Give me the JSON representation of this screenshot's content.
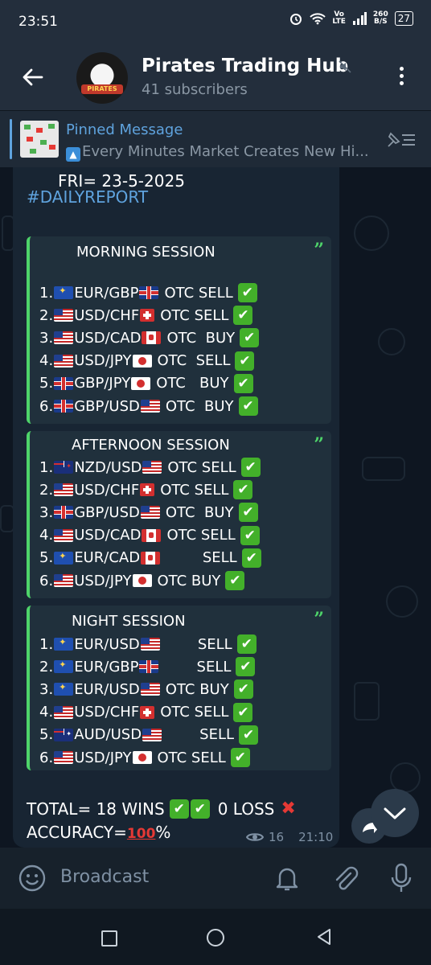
{
  "status": {
    "time": "23:51",
    "net_top": "Vo",
    "net_bottom": "LTE",
    "speed_top": "260",
    "speed_bottom": "B/S",
    "battery": "27"
  },
  "channel": {
    "title": "Pirates Trading Hub",
    "subtitle": "41 subscribers",
    "avatar_text": "PIRATES"
  },
  "pinned": {
    "label": "Pinned Message",
    "text": "Every Minutes Market Creates New Hi..."
  },
  "message": {
    "date_line": "FRI= 23-5-2025",
    "hashtag": "#DAILYREPORT",
    "sessions": [
      {
        "title": "MORNING SESSION",
        "rows": [
          {
            "num": "1.",
            "a": "EUR",
            "b": "GBP",
            "fa": "eu",
            "fb": "gb",
            "side": "OTC SELL"
          },
          {
            "num": "2.",
            "a": "USD",
            "b": "CHF",
            "fa": "us",
            "fb": "ch",
            "side": "OTC SELL"
          },
          {
            "num": "3.",
            "a": "USD",
            "b": "CAD",
            "fa": "us",
            "fb": "ca",
            "side": "OTC  BUY"
          },
          {
            "num": "4.",
            "a": "USD",
            "b": "JPY",
            "fa": "us",
            "fb": "jp",
            "side": "OTC  SELL"
          },
          {
            "num": "5.",
            "a": "GBP",
            "b": "JPY",
            "fa": "gb",
            "fb": "jp",
            "side": "OTC   BUY"
          },
          {
            "num": "6.",
            "a": "GBP",
            "b": "USD",
            "fa": "gb",
            "fb": "us",
            "side": "OTC  BUY"
          }
        ]
      },
      {
        "title": "AFTERNOON SESSION",
        "rows": [
          {
            "num": "1.",
            "a": "NZD",
            "b": "USD",
            "fa": "nz",
            "fb": "us",
            "side": "OTC SELL"
          },
          {
            "num": "2.",
            "a": "USD",
            "b": "CHF",
            "fa": "us",
            "fb": "ch",
            "side": "OTC SELL"
          },
          {
            "num": "3.",
            "a": "GBP",
            "b": "USD",
            "fa": "gb",
            "fb": "us",
            "side": "OTC  BUY"
          },
          {
            "num": "4.",
            "a": "USD",
            "b": "CAD",
            "fa": "us",
            "fb": "ca",
            "side": "OTC SELL"
          },
          {
            "num": "5.",
            "a": "EUR",
            "b": "CAD",
            "fa": "eu",
            "fb": "ca",
            "side": "        SELL"
          },
          {
            "num": "6.",
            "a": "USD",
            "b": "JPY",
            "fa": "us",
            "fb": "jp",
            "side": "OTC BUY"
          }
        ]
      },
      {
        "title": "NIGHT SESSION",
        "rows": [
          {
            "num": "1.",
            "a": "EUR",
            "b": "USD",
            "fa": "eu",
            "fb": "us",
            "side": "       SELL"
          },
          {
            "num": "2.",
            "a": "EUR",
            "b": "GBP",
            "fa": "eu",
            "fb": "gb",
            "side": "       SELL"
          },
          {
            "num": "3.",
            "a": "EUR",
            "b": "USD",
            "fa": "eu",
            "fb": "us",
            "side": "OTC BUY"
          },
          {
            "num": "4.",
            "a": "USD",
            "b": "CHF",
            "fa": "us",
            "fb": "ch",
            "side": "OTC SELL"
          },
          {
            "num": "5.",
            "a": "AUD",
            "b": "USD",
            "fa": "au",
            "fb": "us",
            "side": "       SELL"
          },
          {
            "num": "6.",
            "a": "USD",
            "b": "JPY",
            "fa": "us",
            "fb": "jp",
            "side": "OTC SELL"
          }
        ]
      }
    ],
    "quote_mark": "”",
    "check_symbol": "✔",
    "total_text": "TOTAL= 18 WINS",
    "loss_text": "0 LOSS",
    "cross_symbol": "✖",
    "accuracy_text": "ACCURACY=",
    "accuracy_value": "100",
    "percent": "%",
    "views": "16",
    "time": "21:10"
  },
  "input": {
    "placeholder": "Broadcast"
  },
  "icons": [
    "back-arrow-icon",
    "mute-icon",
    "more-vertical-icon",
    "pinned-list-icon",
    "emoji-icon",
    "bell-icon",
    "attach-icon",
    "mic-icon",
    "eye-icon",
    "share-icon",
    "chevron-down-icon"
  ],
  "colors": {
    "accent": "#5fa3de",
    "quote_bar": "#4ed46a",
    "check": "#43b02a",
    "cross": "#e53935"
  }
}
